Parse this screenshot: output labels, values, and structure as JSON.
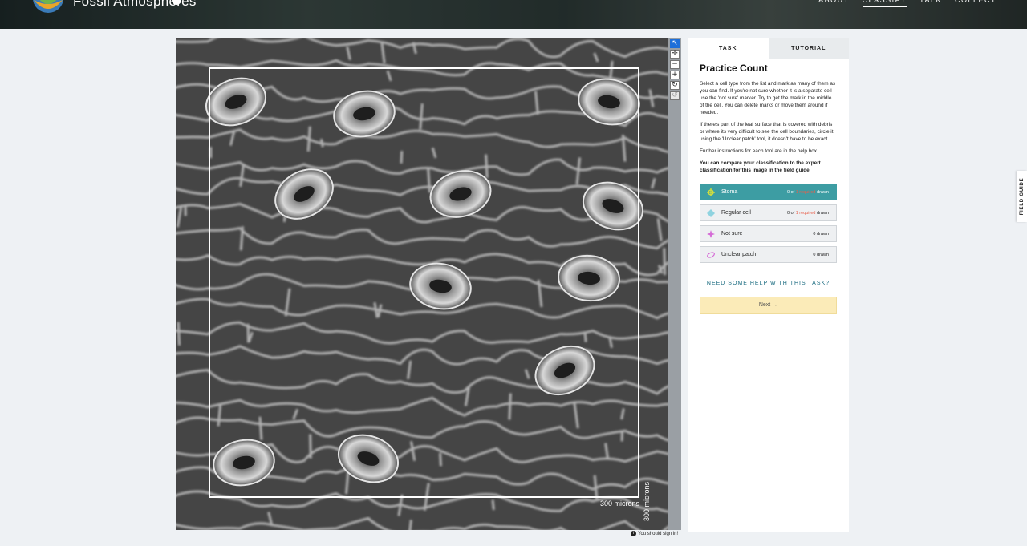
{
  "header": {
    "project_name": "Fossil Atmospheres",
    "nav": [
      "ABOUT",
      "CLASSIFY",
      "TALK",
      "COLLECT"
    ],
    "active_nav": "CLASSIFY"
  },
  "subject": {
    "scale_horizontal": "300 microns",
    "scale_vertical": "300 microns"
  },
  "toolbar": {
    "tools": [
      "pointer-icon",
      "pan-icon",
      "zoom-out-icon",
      "zoom-in-icon",
      "rotate-icon",
      "reset-icon"
    ]
  },
  "signin_notice": "You should sign in!",
  "task_panel": {
    "tabs": [
      "TASK",
      "TUTORIAL"
    ],
    "title": "Practice Count",
    "paragraphs": [
      "Select a cell type from the list and mark as many of them as you can find. If you're not sure whether it is a separate cell use the 'not sure' marker. Try to get the mark in the middle of the cell. You can delete marks or move them around if needed.",
      "If there's part of the leaf surface that is covered with debris or where its very difficult to see the cell boundaries, circle it using the 'Unclear patch' tool, it doesn't have to be exact.",
      "Further instructions for each tool are in the help box."
    ],
    "bold_paragraph": "You can compare your classification to the expert classification for this image in the field guide",
    "tools": [
      {
        "name": "Stoma",
        "count_prefix": "0 of",
        "required": "1 required",
        "count_suffix": "drawn",
        "icon": "stoma-crosshair-icon",
        "color": "#d7e03a"
      },
      {
        "name": "Regular cell",
        "count_prefix": "0 of",
        "required": "1 required",
        "count_suffix": "drawn",
        "icon": "regular-cell-diamond-icon",
        "color": "#8fd3e0"
      },
      {
        "name": "Not sure",
        "count_prefix": "",
        "required": "",
        "count_suffix": "0 drawn",
        "icon": "not-sure-star-icon",
        "color": "#d56bd6"
      },
      {
        "name": "Unclear patch",
        "count_prefix": "",
        "required": "",
        "count_suffix": "0 drawn",
        "icon": "unclear-patch-ellipse-icon",
        "color": "#d56bd6"
      }
    ],
    "help_link": "NEED SOME HELP WITH THIS TASK?",
    "next_label": "Next →"
  },
  "field_guide_label": "FIELD GUIDE"
}
